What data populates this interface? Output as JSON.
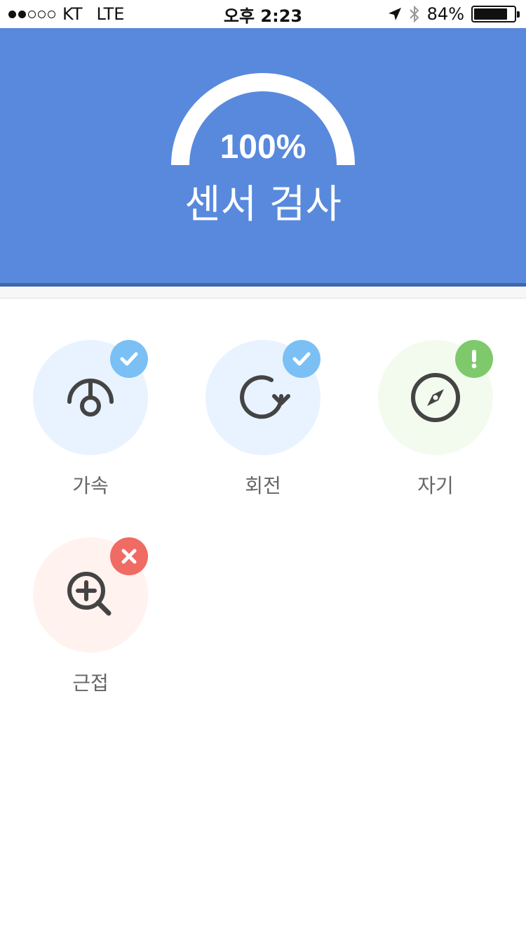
{
  "status_bar": {
    "carrier": "KT",
    "network": "LTE",
    "time": "오후 2:23",
    "battery_percent": "84%",
    "battery_level": 0.84,
    "signal_bars_filled": 2,
    "signal_bars_total": 5
  },
  "header": {
    "percent": "100%",
    "title": "센서 검사",
    "progress": 1.0,
    "background_color": "#5889dc"
  },
  "sensors": [
    {
      "label": "가속",
      "icon": "accelerometer-icon",
      "status": "pass",
      "status_icon": "check-icon",
      "circle_color": "#e8f3ff",
      "badge_color": "#7ac0f5"
    },
    {
      "label": "회전",
      "icon": "rotation-icon",
      "status": "pass",
      "status_icon": "check-icon",
      "circle_color": "#e8f3ff",
      "badge_color": "#7ac0f5"
    },
    {
      "label": "자기",
      "icon": "compass-icon",
      "status": "warning",
      "status_icon": "exclamation-icon",
      "circle_color": "#f3fbef",
      "badge_color": "#7fc96d"
    },
    {
      "label": "근접",
      "icon": "zoom-in-icon",
      "status": "fail",
      "status_icon": "close-icon",
      "circle_color": "#fff2ef",
      "badge_color": "#f06b63"
    }
  ]
}
